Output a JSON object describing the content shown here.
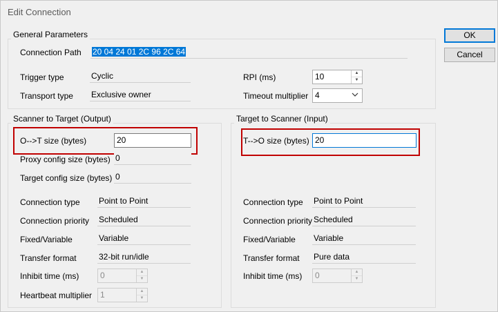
{
  "window": {
    "title": "Edit Connection"
  },
  "buttons": {
    "ok": "OK",
    "cancel": "Cancel"
  },
  "general": {
    "group_label": "General Parameters",
    "connection_path_label": "Connection Path",
    "connection_path_value": "20 04 24 01 2C 96 2C 64",
    "trigger_type_label": "Trigger type",
    "trigger_type_value": "Cyclic",
    "transport_type_label": "Transport type",
    "transport_type_value": "Exclusive owner",
    "rpi_label": "RPI (ms)",
    "rpi_value": "10",
    "timeout_label": "Timeout multiplier",
    "timeout_value": "4"
  },
  "s2t": {
    "group_label": "Scanner to Target (Output)",
    "size_label": "O-->T size (bytes)",
    "size_value": "20",
    "proxy_label": "Proxy config size (bytes)",
    "proxy_value": "0",
    "target_cfg_label": "Target config size (bytes)",
    "target_cfg_value": "0",
    "conn_type_label": "Connection type",
    "conn_type_value": "Point to Point",
    "priority_label": "Connection priority",
    "priority_value": "Scheduled",
    "fixed_label": "Fixed/Variable",
    "fixed_value": "Variable",
    "transfer_label": "Transfer format",
    "transfer_value": "32-bit run/idle",
    "inhibit_label": "Inhibit time (ms)",
    "inhibit_value": "0",
    "heartbeat_label": "Heartbeat multiplier",
    "heartbeat_value": "1"
  },
  "t2s": {
    "group_label": "Target to Scanner (Input)",
    "size_label": "T-->O size (bytes)",
    "size_value": "20",
    "conn_type_label": "Connection type",
    "conn_type_value": "Point to Point",
    "priority_label": "Connection priority",
    "priority_value": "Scheduled",
    "fixed_label": "Fixed/Variable",
    "fixed_value": "Variable",
    "transfer_label": "Transfer format",
    "transfer_value": "Pure data",
    "inhibit_label": "Inhibit time (ms)",
    "inhibit_value": "0"
  },
  "colors": {
    "highlight": "#c00000",
    "accent": "#0078d7"
  },
  "icons": {
    "spin_up": "▲",
    "spin_down": "▼",
    "dropdown": "chevron-down-icon"
  }
}
